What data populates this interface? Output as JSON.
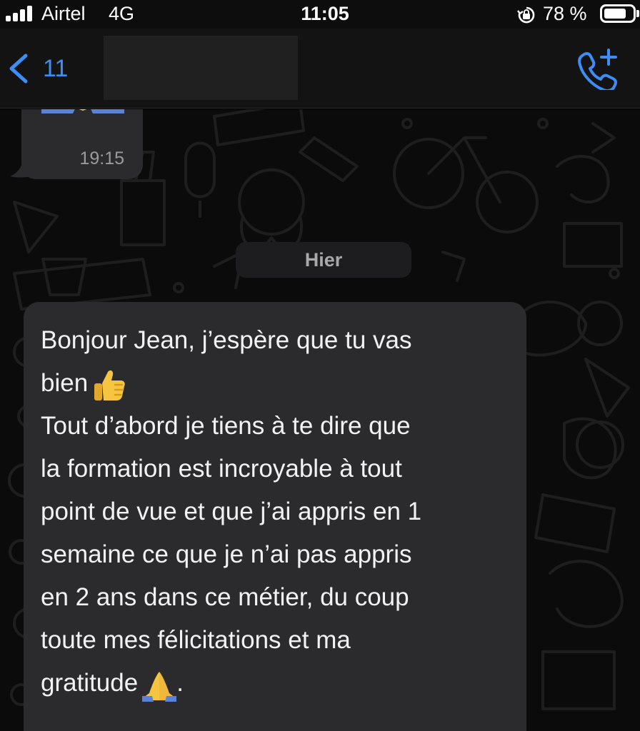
{
  "status_bar": {
    "carrier": "Airtel",
    "network": "4G",
    "time": "11:05",
    "battery_percent": "78 %",
    "battery_level": 0.78
  },
  "header": {
    "back_count": "11",
    "back_icon": "chevron-left-icon",
    "call_icon": "add-call-icon",
    "accent_color": "#3d8df5"
  },
  "chat": {
    "previous_message": {
      "time": "19:15",
      "emoji": "folded-hands-icon"
    },
    "date_separator": "Hier",
    "message": {
      "lines": [
        "Bonjour Jean, j’espère que tu vas",
        "bien",
        "Tout d’abord je tiens à te dire que",
        "la formation est incroyable à tout",
        "point de vue et que j’ai appris en 1",
        "semaine ce que je n’ai pas appris",
        "en 2 ans dans ce métier, du coup",
        "toute mes félicitations et ma",
        "gratitude",
        "."
      ],
      "emojis": [
        "thumbs-up-icon",
        "folded-hands-icon"
      ]
    }
  }
}
